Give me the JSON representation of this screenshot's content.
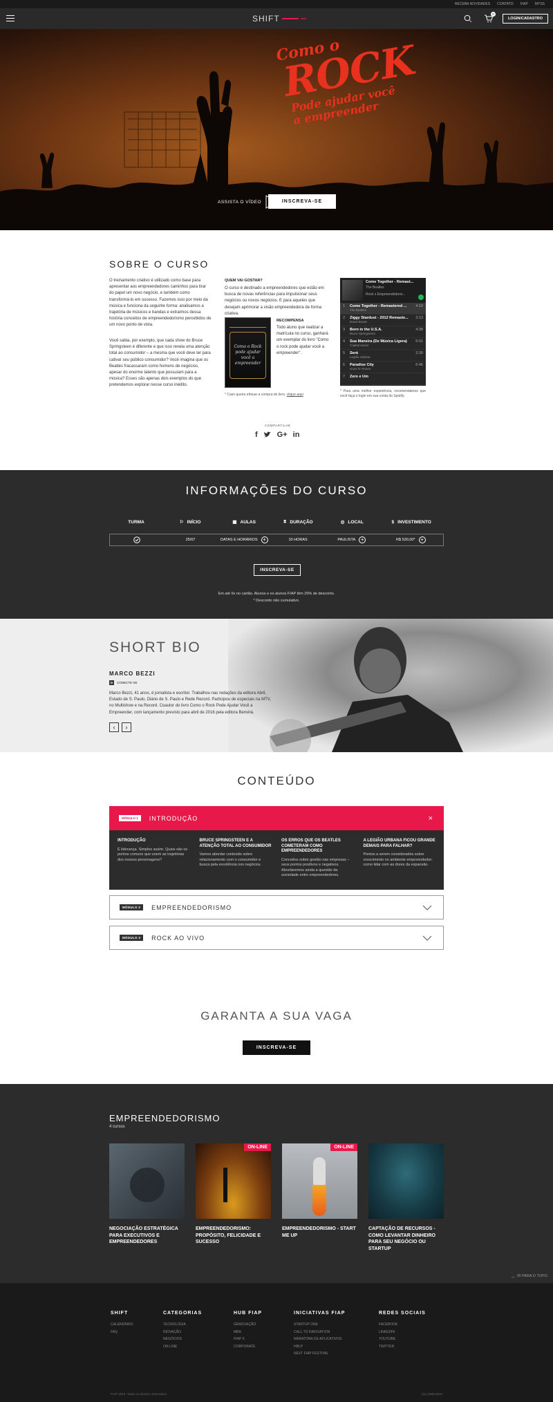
{
  "topbar": {
    "links": [
      "RECEBA NOVIDADES",
      "CONTATO",
      "FIAP",
      "MYSS"
    ]
  },
  "nav": {
    "logo": "SHIFT",
    "login": "LOGIN/CADASTRO",
    "cart_count": "0"
  },
  "hero": {
    "title_lines": [
      "Como o",
      "ROCK",
      "Pode ajudar você",
      "a empreender"
    ],
    "watch_label": "ASSISTA O VÍDEO",
    "cta": "INSCREVA-SE"
  },
  "about": {
    "title": "SOBRE O CURSO",
    "p1": "O treinamento criativo é utilizado como base para apresentar aos empreendedores caminhos para tirar do papel um novo negócio, e também como transformá-lo em sucesso. Fazemos isso por meio da música e funciona da seguinte forma: analisamos a trajetória de músicos e bandas e extraímos dessa história conceitos de empreendedorismo percebidos de um novo ponto de vista.",
    "p2": "Você sabia, por exemplo, que cada show do Bruce Springsteen é diferente e que isso revela uma atenção total ao consumidor – a mesma que você deve ter para cativar seu público consumidor? Você imagina que os Beatles fracassaram como homens de negócios, apesar do enorme talento que possuíam para a música? Esses são apenas dois exemplos do que pretendemos explorar nesse curso inédito.",
    "who_title": "QUEM VAI GOSTAR?",
    "who_text": "O curso é destinado a empreendedores que estão em busca de novas referências para impulsionar seus negócios ou novos negócios. E para aqueles que desejam aprimorar a visão empreendedora de forma criativa.",
    "book_cover": "Como o Rock pode ajudar você a empreender",
    "reward_title": "RECOMPENSA",
    "reward_text": "Todo aluno que realizar a matrícula no curso, ganhará um exemplar do livro \"Como o rock pode ajudar você a empreender\".",
    "note": "* Caso queira efetuar a compra do livro,",
    "note_link": "clique aqui",
    "playlist": {
      "header_title": "Come Together - Remast...",
      "header_artist": "The Beatles",
      "header_sub": "Rock x Empreendedoris...",
      "tracks": [
        {
          "n": "1",
          "title": "Come Together - Remastered ...",
          "artist": "The Beatles",
          "time": "4:19"
        },
        {
          "n": "2",
          "title": "Ziggy Stardust - 2012 Remaste...",
          "artist": "David Bowie",
          "time": "3:13"
        },
        {
          "n": "3",
          "title": "Born in the U.S.A.",
          "artist": "Bruce Springsteen",
          "time": "4:38"
        },
        {
          "n": "4",
          "title": "Sua Maneira (De Música Ligera)",
          "artist": "Capital Inicial",
          "time": "5:01"
        },
        {
          "n": "5",
          "title": "Será",
          "artist": "Legião Urbana",
          "time": "2:30"
        },
        {
          "n": "6",
          "title": "Paradise City",
          "artist": "Guns N' Roses",
          "time": "6:46"
        },
        {
          "n": "7",
          "title": "Zero e Um",
          "artist": "",
          "time": ""
        }
      ],
      "note": "* Para uma melhor experiência, recomendamos que você faça o login em sua conta do Spotify."
    },
    "share_label": "COMPARTILHE"
  },
  "info": {
    "title": "INFORMAÇÕES DO CURSO",
    "cols": [
      {
        "head": "TURMA",
        "value": ""
      },
      {
        "head": "INÍCIO",
        "value": "25/07"
      },
      {
        "head": "AULAS",
        "value": "DATAS E HORÁRIOS"
      },
      {
        "head": "DURAÇÃO",
        "value": "10 HORAS"
      },
      {
        "head": "LOCAL",
        "value": "PAULISTA"
      },
      {
        "head": "INVESTIMENTO",
        "value": "R$ 530,00*"
      }
    ],
    "cta": "INSCREVA-SE",
    "note1": "Em até 6x no cartão. Alunos e ex-alunos FIAP têm 20% de desconto.",
    "note2": "* Desconto não cumulativo."
  },
  "bio": {
    "title": "SHORT BIO",
    "name": "MARCO BEZZI",
    "linkedin": "CONECTE-SE",
    "text": "Marco Bezzi, 41 anos, é jornalista e escritor. Trabalhou nas redações da editora Abril, Estado de S. Paulo, Diário de S. Paulo e Rede Record. Participou de especiais na MTV, no Multishow e na Record. Coautor do livro Como o Rock Pode Ajudar Você a Empreender, com lançamento previsto para abril de 2016 pela editora Benvirá."
  },
  "content": {
    "title": "CONTEÚDO",
    "modules": [
      {
        "badge": "MÓDULO 1",
        "title": "INTRODUÇÃO"
      },
      {
        "badge": "MÓDULO 2",
        "title": "EMPREENDEDORISMO"
      },
      {
        "badge": "MÓDULO 3",
        "title": "ROCK AO VIVO"
      }
    ],
    "lessons": [
      {
        "title": "INTRODUÇÃO",
        "text": "É liderança. Simples assim. Quais são os pontos comuns que unem as trajetórias dos nossos personagens?"
      },
      {
        "title": "BRUCE SPRINGSTEEN E A ATENÇÃO TOTAL AO CONSUMIDOR",
        "text": "Vamos abordar conteúdo sobre relacionamento com o consumidor e busca pela excelência nos negócios."
      },
      {
        "title": "OS ERROS QUE OS BEATLES COMETERAM COMO EMPREENDEDORES",
        "text": "Conceitos sobre gestão nas empresas – seus pontos positivos e negativos. Abordaremos ainda a questão da sociedade entre empreendedores."
      },
      {
        "title": "A LEGIÃO URBANA FICOU GRANDE DEMAIS PARA FALHAR?",
        "text": "Pontos a serem considerados sobre crescimento no ambiente empreendedor: como lidar com as dores da expansão."
      }
    ]
  },
  "guarantee": {
    "title": "GARANTA A SUA VAGA",
    "cta": "INSCREVA-SE"
  },
  "related": {
    "title": "EMPREENDEDORISMO",
    "count": "4 cursos",
    "cards": [
      {
        "title": "NEGOCIAÇÃO ESTRATÉGICA PARA EXECUTIVOS E EMPREENDEDORES",
        "badge": ""
      },
      {
        "title": "EMPREENDEDORISMO: PROPÓSITO, FELICIDADE E SUCESSO",
        "badge": "ON-LINE"
      },
      {
        "title": "EMPREENDEDORISMO - START ME UP",
        "badge": "ON-LINE"
      },
      {
        "title": "CAPTAÇÃO DE RECURSOS - COMO LEVANTAR DINHEIRO PARA SEU NEGÓCIO OU STARTUP",
        "badge": ""
      }
    ],
    "back_top": "IR PARA O TOPO"
  },
  "footer": {
    "cols": [
      {
        "head": "SHIFT",
        "links": [
          "CALENDÁRIO",
          "FAQ"
        ]
      },
      {
        "head": "CATEGORIAS",
        "links": [
          "TECNOLOGIA",
          "INOVAÇÃO",
          "NEGÓCIOS",
          "ON-LINE"
        ]
      },
      {
        "head": "HUB FIAP",
        "links": [
          "GRADUAÇÃO",
          "MBA",
          "FIAP X",
          "CORPORATE"
        ]
      },
      {
        "head": "INICIATIVAS FIAP",
        "links": [
          "STARTUP ONE",
          "CALL TO INNOVATION",
          "MARATONA DE APLICATIVOS",
          "HBLP",
          "NEXT FIAP FESTIVAL"
        ]
      },
      {
        "head": "REDES SOCIAIS",
        "links": [
          "FACEBOOK",
          "LINKEDIN",
          "YOUTUBE",
          "TWITTER"
        ]
      }
    ],
    "copyright": "FIAP 2015. Todos os direitos reservados.",
    "phone": "(11) 3385-8010"
  },
  "colors": {
    "accent": "#e8194a",
    "dark": "#2c2c2c",
    "hero_title": "#e8311e"
  }
}
